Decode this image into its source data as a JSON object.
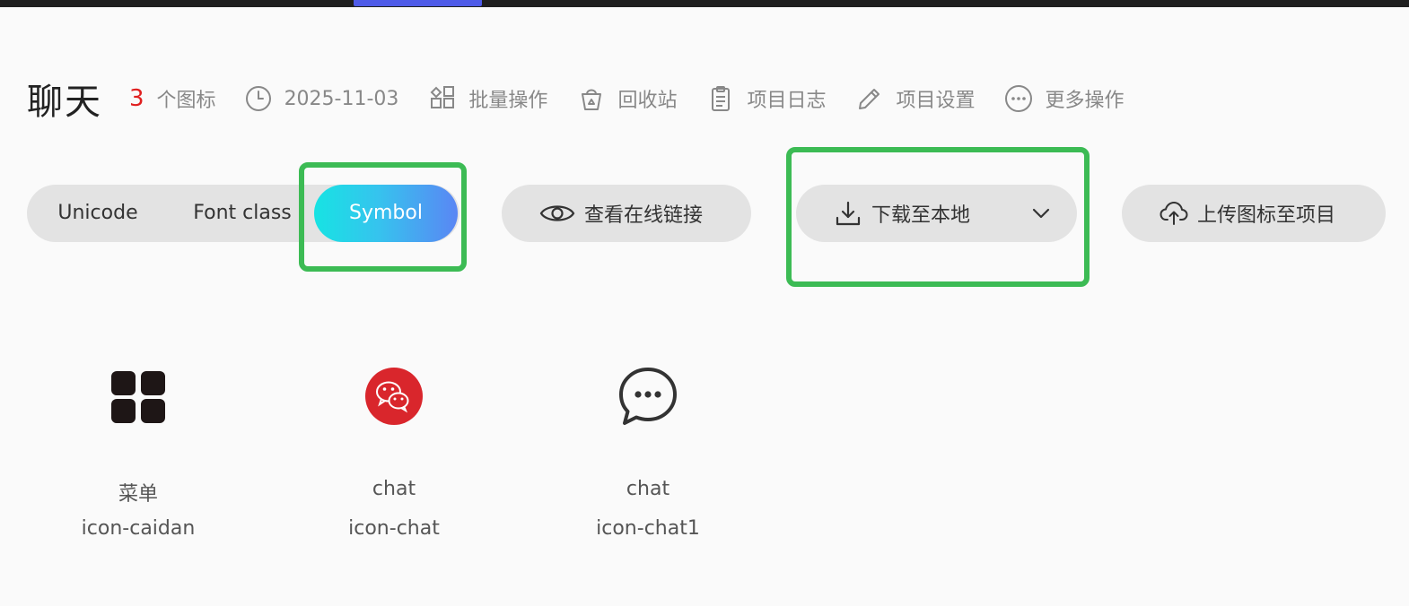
{
  "project": {
    "title": "聊天",
    "icon_count": "3",
    "icon_count_label": "个图标",
    "date": "2025-11-03"
  },
  "header_actions": [
    {
      "label": "批量操作",
      "icon": "batch-grid-icon"
    },
    {
      "label": "回收站",
      "icon": "recycle-bin-icon"
    },
    {
      "label": "项目日志",
      "icon": "clipboard-log-icon"
    },
    {
      "label": "项目设置",
      "icon": "pencil-settings-icon"
    },
    {
      "label": "更多操作",
      "icon": "more-dots-icon"
    }
  ],
  "format_tabs": {
    "items": [
      "Unicode",
      "Font class",
      "Symbol"
    ],
    "selected": "Symbol"
  },
  "toolbar": {
    "view_online_link": "查看在线链接",
    "download_local": "下载至本地",
    "upload_to_project": "上传图标至项目"
  },
  "icons": [
    {
      "name": "菜单",
      "code": "icon-caidan",
      "glyph": "menu-grid-icon",
      "color": "#1e1616"
    },
    {
      "name": "chat",
      "code": "icon-chat",
      "glyph": "wechat-icon",
      "color": "#d9262c"
    },
    {
      "name": "chat",
      "code": "icon-chat1",
      "glyph": "chat-bubble-icon",
      "color": "#333333"
    }
  ],
  "colors": {
    "accent_gradient_start": "#17e3e3",
    "accent_gradient_end": "#5a86f4",
    "highlight": "#3cbb54",
    "count": "#e02020"
  }
}
